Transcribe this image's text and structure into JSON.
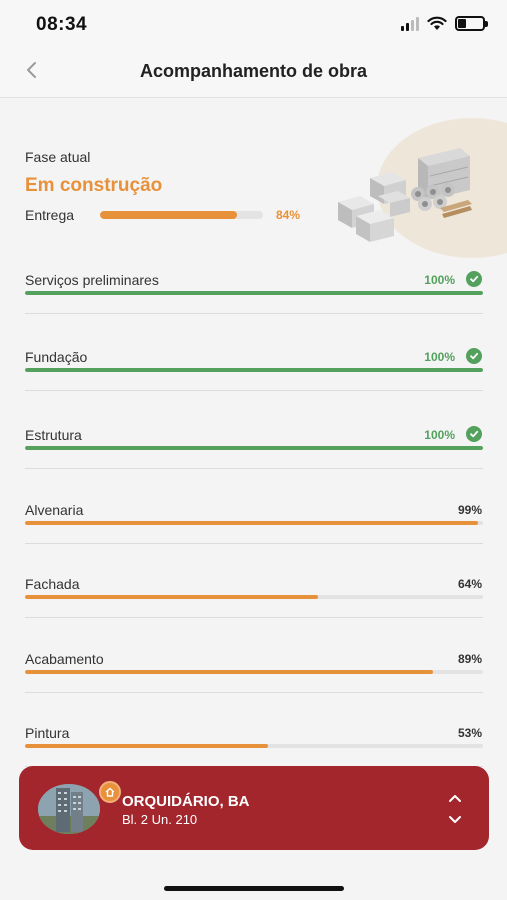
{
  "status_bar": {
    "time": "08:34"
  },
  "header": {
    "title": "Acompanhamento de obra"
  },
  "phase": {
    "label": "Fase atual",
    "value": "Em construção",
    "delivery_label": "Entrega",
    "delivery_percent": 84,
    "delivery_percent_text": "84%"
  },
  "stages": [
    {
      "name": "Serviços preliminares",
      "percent": 100,
      "percent_text": "100%",
      "complete": true
    },
    {
      "name": "Fundação",
      "percent": 100,
      "percent_text": "100%",
      "complete": true
    },
    {
      "name": "Estrutura",
      "percent": 100,
      "percent_text": "100%",
      "complete": true
    },
    {
      "name": "Alvenaria",
      "percent": 99,
      "percent_text": "99%",
      "complete": false
    },
    {
      "name": "Fachada",
      "percent": 64,
      "percent_text": "64%",
      "complete": false
    },
    {
      "name": "Acabamento",
      "percent": 89,
      "percent_text": "89%",
      "complete": false
    },
    {
      "name": "Pintura",
      "percent": 53,
      "percent_text": "53%",
      "complete": false
    }
  ],
  "unit": {
    "name": "ORQUIDÁRIO, BA",
    "detail": "Bl. 2 Un. 210"
  },
  "colors": {
    "accent_orange": "#e8913b",
    "complete_green": "#54a15d",
    "card_red": "#a3262d"
  },
  "icons": [
    "chevron-left-icon",
    "cell-signal-icon",
    "wifi-icon",
    "battery-icon",
    "check-circle-icon",
    "home-icon",
    "chevron-up-icon",
    "chevron-down-icon"
  ]
}
